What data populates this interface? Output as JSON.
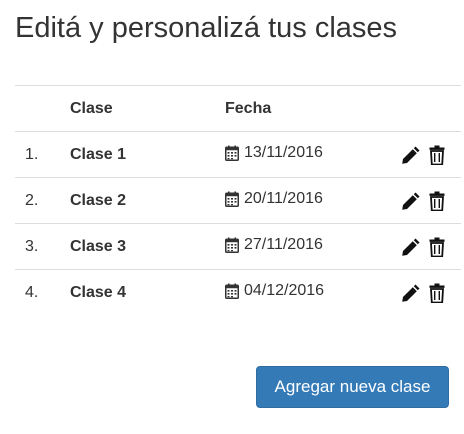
{
  "page": {
    "title": "Editá y personalizá tus clases"
  },
  "table": {
    "headers": {
      "index": "",
      "name": "Clase",
      "date": "Fecha",
      "actions": ""
    },
    "rows": [
      {
        "index": "1.",
        "name": "Clase 1",
        "date": "13/11/2016"
      },
      {
        "index": "2.",
        "name": "Clase 2",
        "date": "20/11/2016"
      },
      {
        "index": "3.",
        "name": "Clase 3",
        "date": "27/11/2016"
      },
      {
        "index": "4.",
        "name": "Clase 4",
        "date": "04/12/2016"
      }
    ],
    "row_icons": {
      "date": "calendar-icon",
      "edit": "pencil-icon",
      "delete": "trash-icon"
    }
  },
  "actions": {
    "add_label": "Agregar nueva clase"
  },
  "colors": {
    "primary": "#337ab7",
    "text": "#333333",
    "border": "#dddddd"
  }
}
